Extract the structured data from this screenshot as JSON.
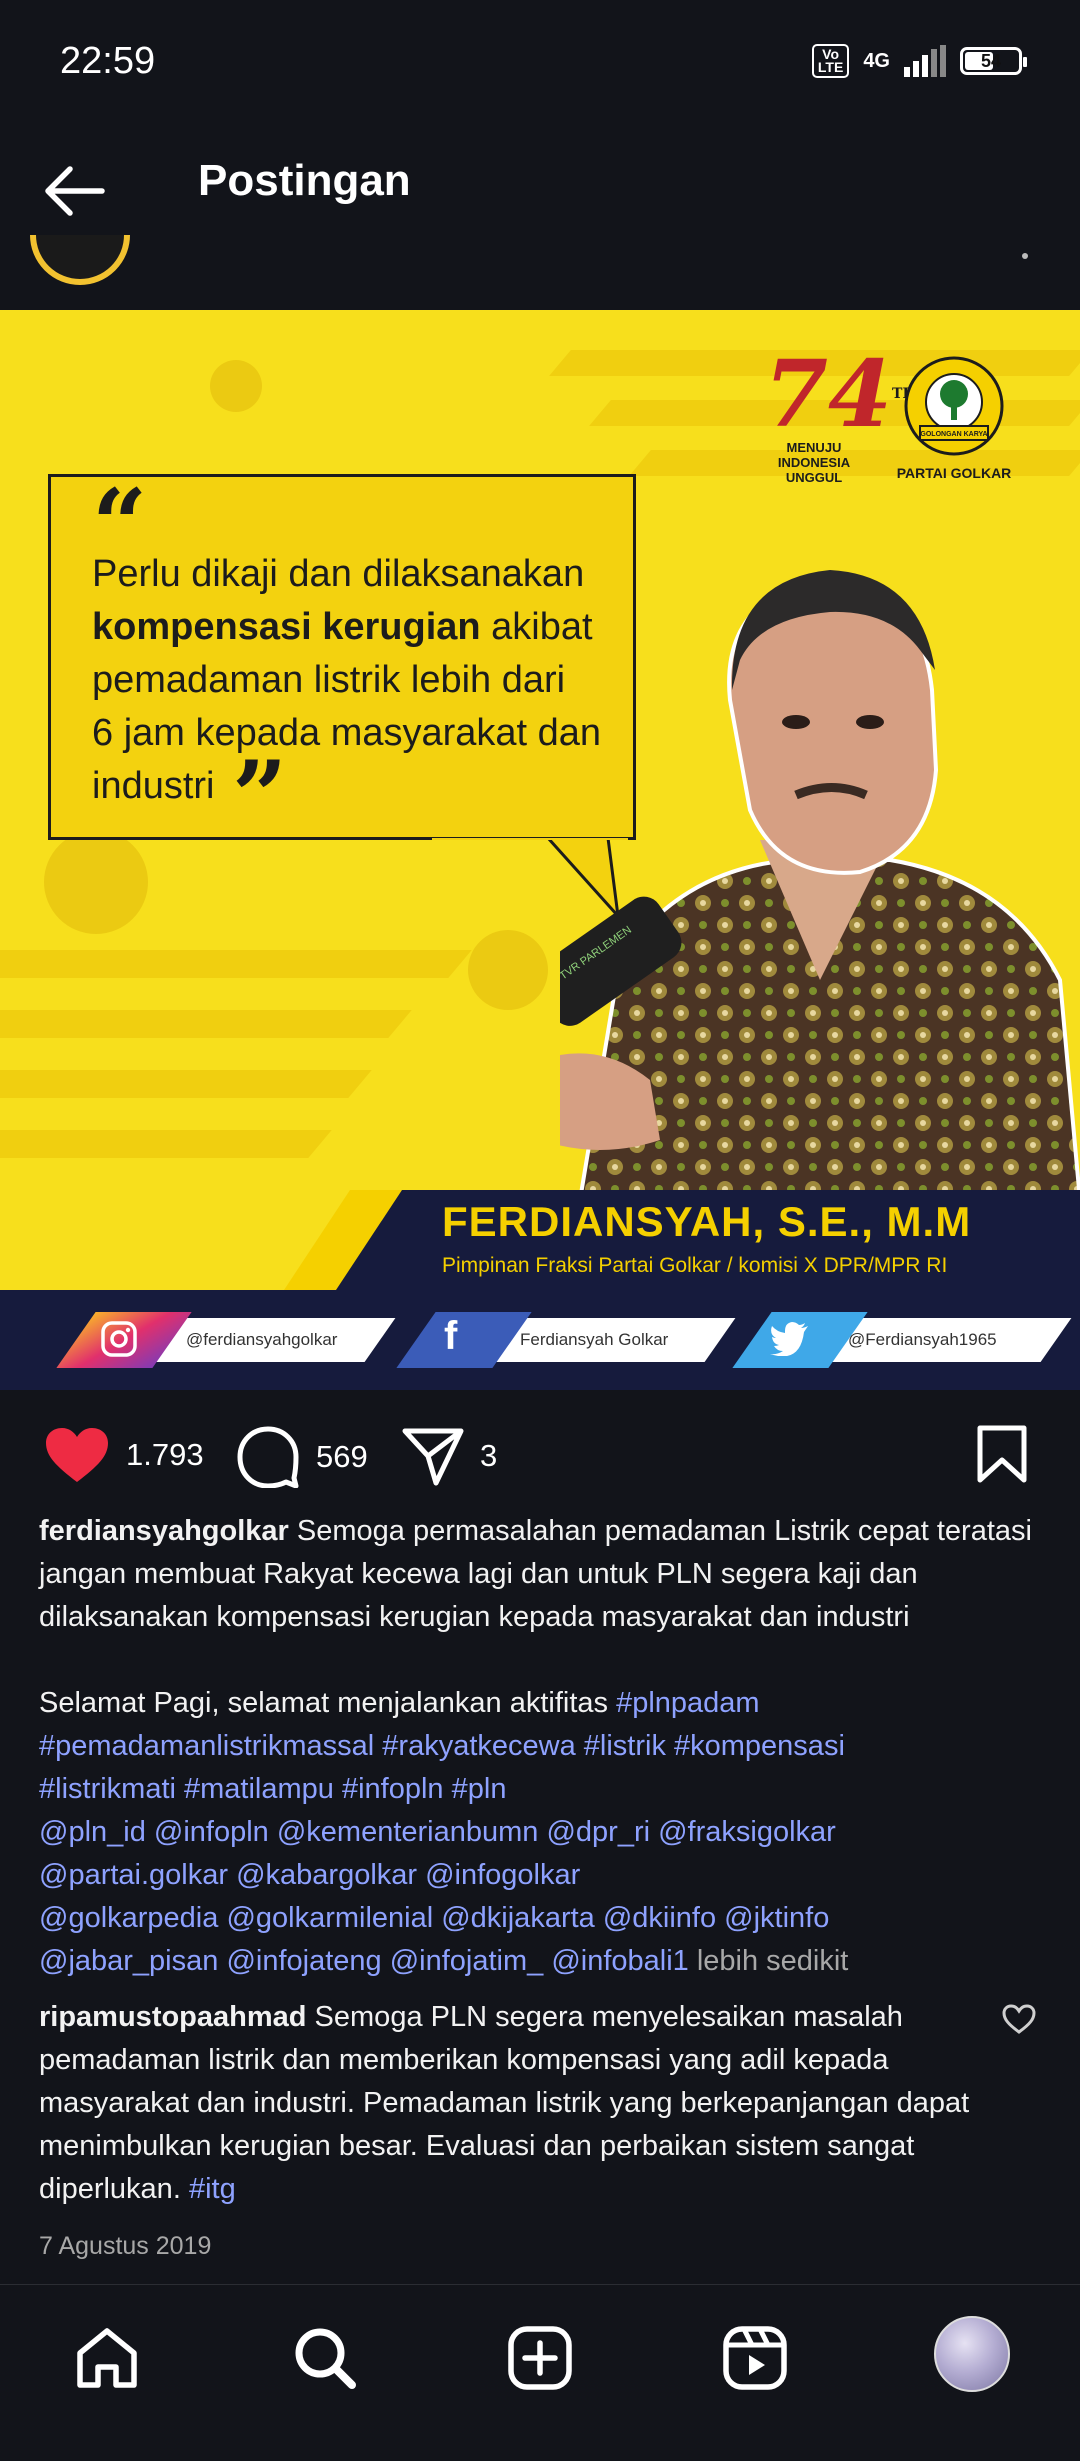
{
  "status_bar": {
    "time": "22:59",
    "volte": "Vo LTE",
    "network": "4G",
    "battery": "54",
    "battery_level": 0.54
  },
  "header": {
    "title": "Postingan"
  },
  "post_image": {
    "quote_open": "“",
    "quote_close": "”",
    "quote_line1": "Perlu dikaji dan dilaksanakan",
    "quote_bold": "kompensasi kerugian",
    "quote_line2_rest": " akibat",
    "quote_line3": "pemadaman listrik lebih dari",
    "quote_line4": "6 jam kepada masyarakat dan",
    "quote_line5": "industri",
    "anniversary_number": "74",
    "anniversary_th": "TH",
    "anniversary_sub1": "MENUJU",
    "anniversary_sub2": "INDONESIA",
    "anniversary_sub3": "UNGGUL",
    "golkar_ribbon": "GOLONGAN KARYA",
    "golkar_label": "PARTAI GOLKAR",
    "mic_label": "TVR PARLEMEN",
    "name": "FERDIANSYAH, S.E., M.M",
    "role": "Pimpinan Fraksi Partai Golkar / komisi X DPR/MPR RI",
    "social": [
      {
        "icon": "instagram-icon",
        "handle": "@ferdiansyahgolkar"
      },
      {
        "icon": "facebook-icon",
        "handle": "Ferdiansyah Golkar"
      },
      {
        "icon": "twitter-icon",
        "handle": "@Ferdiansyah1965"
      }
    ],
    "colors": {
      "background": "#f7df1c",
      "band": "#161b3d",
      "accent": "#f5d000"
    }
  },
  "actions": {
    "likes": "1.793",
    "comments": "569",
    "shares": "3"
  },
  "caption": {
    "username": "ferdiansyahgolkar",
    "text": " Semoga permasalahan pemadaman Listrik cepat teratasi jangan membuat Rakyat kecewa lagi dan untuk PLN segera kaji dan dilaksanakan kompensasi kerugian kepada masyarakat dan industri",
    "greeting": "Selamat Pagi, selamat menjalankan aktifitas ",
    "hashtags1": "#plnpadam",
    "hashtags2": "#pemadamanlistrikmassal #rakyatkecewa #listrik #kompensasi",
    "hashtags3": "#listrikmati #matilampu #infopln #pln",
    "mentions1": "@pln_id @infopln  @kementerianbumn @dpr_ri @fraksigolkar",
    "mentions2": "@partai.golkar @kabargolkar @infogolkar",
    "mentions3": "@golkarpedia @golkarmilenial @dkijakarta @dkiinfo @jktinfo",
    "mentions4": "@jabar_pisan @infojateng @infojatim_ @infobali1",
    "less": " lebih sedikit"
  },
  "comment": {
    "username": "ripamustopaahmad",
    "text": " Semoga PLN segera menyelesaikan masalah pemadaman listrik dan memberikan kompensasi yang adil kepada masyarakat dan industri. Pemadaman listrik yang berkepanjangan dapat menimbulkan kerugian besar. Evaluasi dan perbaikan sistem sangat diperlukan. ",
    "hashtag": "#itg"
  },
  "date": "7 Agustus 2019",
  "nav": [
    "home-icon",
    "search-icon",
    "create-icon",
    "reels-icon",
    "profile-avatar"
  ]
}
